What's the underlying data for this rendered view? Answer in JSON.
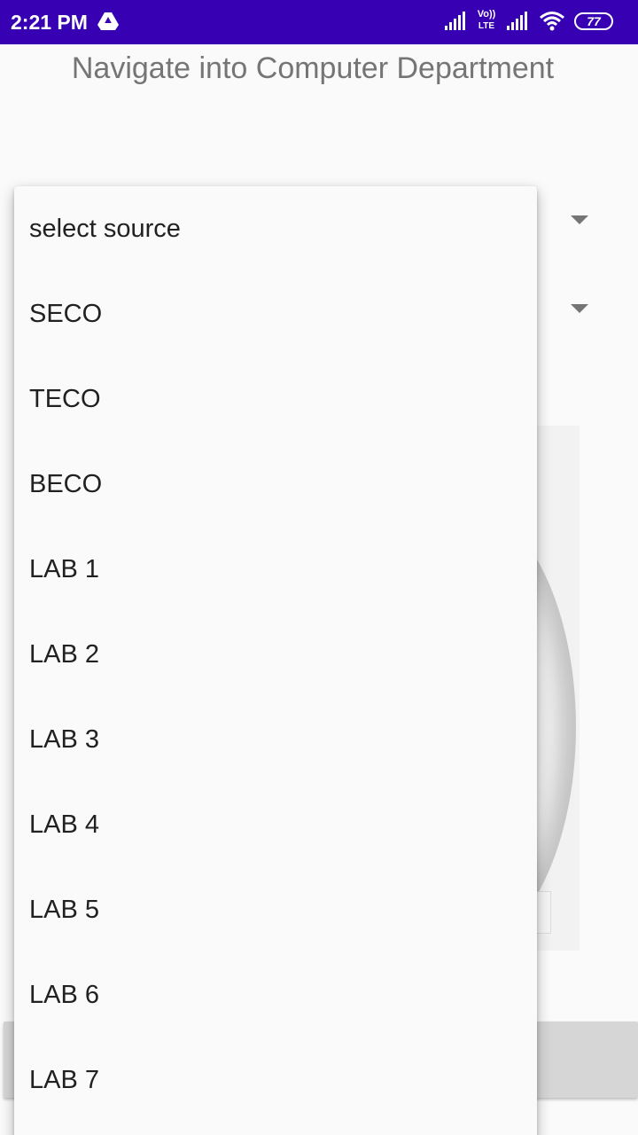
{
  "status_bar": {
    "time": "2:21 PM",
    "network_top": "Vo))",
    "network_bottom": "LTE",
    "battery": "77",
    "icons": [
      "drive-icon",
      "signal-icon",
      "volte-icon",
      "signal-icon",
      "wifi-icon",
      "battery-icon"
    ],
    "background_color": "#3700b3"
  },
  "page": {
    "title": "Navigate into Computer Department"
  },
  "dropdown": {
    "items": [
      "select source",
      "SECO",
      "TECO",
      "BECO",
      "LAB 1",
      "LAB 2",
      "LAB 3",
      "LAB 4",
      "LAB 5",
      "LAB 6",
      "LAB 7"
    ]
  }
}
